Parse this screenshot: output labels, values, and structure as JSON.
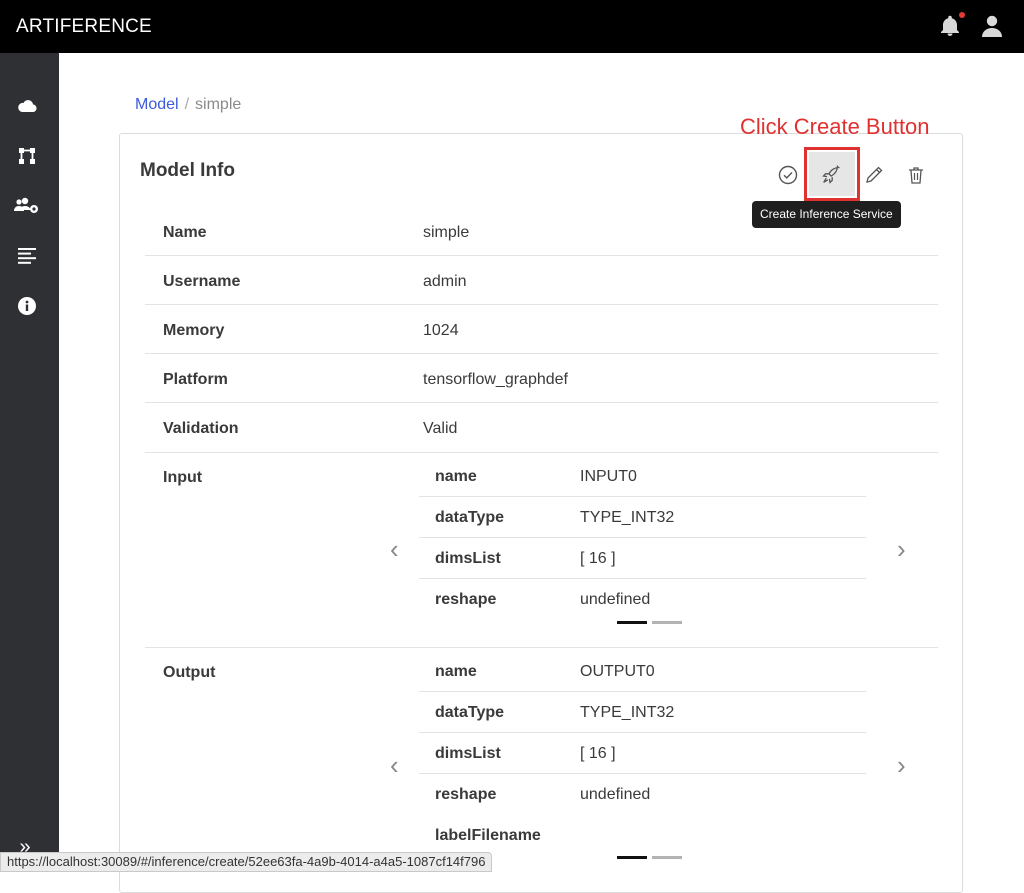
{
  "app": {
    "title": "ARTIFERENCE"
  },
  "breadcrumb": {
    "link": "Model",
    "separator": "/",
    "current": "simple"
  },
  "card": {
    "title": "Model Info",
    "annotation": "Click Create Button",
    "tooltip": "Create Inference Service",
    "actions": [
      "validate-icon",
      "rocket-icon",
      "pencil-icon",
      "trash-icon"
    ]
  },
  "info": {
    "name": {
      "label": "Name",
      "value": "simple"
    },
    "username": {
      "label": "Username",
      "value": "admin"
    },
    "memory": {
      "label": "Memory",
      "value": "1024"
    },
    "platform": {
      "label": "Platform",
      "value": "tensorflow_graphdef"
    },
    "validation": {
      "label": "Validation",
      "value": "Valid"
    },
    "input": {
      "label": "Input",
      "fields": [
        {
          "key": "name",
          "value": "INPUT0"
        },
        {
          "key": "dataType",
          "value": "TYPE_INT32"
        },
        {
          "key": "dimsList",
          "value": "[ 16 ]"
        },
        {
          "key": "reshape",
          "value": "undefined"
        }
      ]
    },
    "output": {
      "label": "Output",
      "fields": [
        {
          "key": "name",
          "value": "OUTPUT0"
        },
        {
          "key": "dataType",
          "value": "TYPE_INT32"
        },
        {
          "key": "dimsList",
          "value": "[ 16 ]"
        },
        {
          "key": "reshape",
          "value": "undefined"
        },
        {
          "key": "labelFilename",
          "value": ""
        }
      ]
    },
    "carousel": {
      "prev": "‹",
      "next": "›",
      "active_slide": 1,
      "slide_count": 2
    }
  },
  "sidebar": {
    "items": [
      "cloud-icon",
      "workflow-icon",
      "users-gear-icon",
      "list-icon",
      "info-icon"
    ],
    "expand": "»"
  },
  "statusbar": {
    "url": "https://localhost:30089/#/inference/create/52ee63fa-4a9b-4014-a4a5-1087cf14f796"
  },
  "colors": {
    "accent": "#3b5bdb",
    "annotation": "#e03131",
    "topbar": "#000000",
    "sidebar": "#2f3033"
  }
}
